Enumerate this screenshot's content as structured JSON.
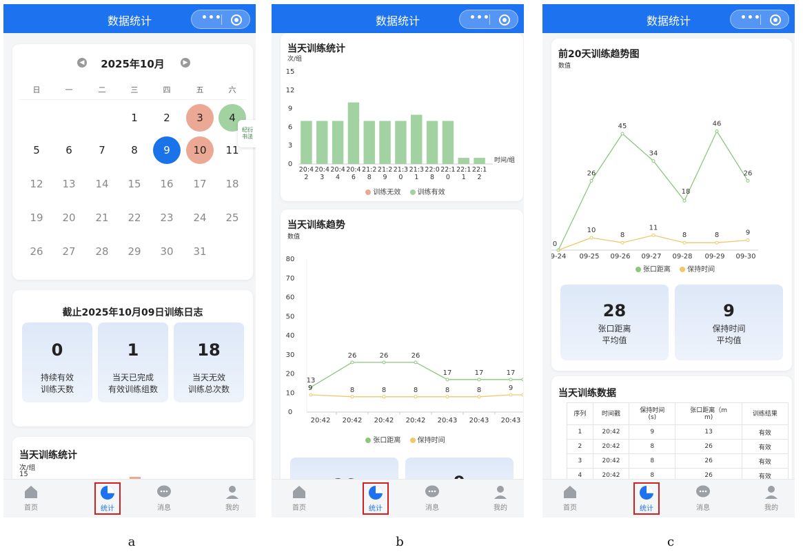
{
  "nav": {
    "title": "数据统计",
    "more_icon": "more-dots-icon",
    "close_icon": "target-circle-icon"
  },
  "tabbar": {
    "items": [
      {
        "label": "首页",
        "icon": "home-icon"
      },
      {
        "label": "统计",
        "icon": "pie-chart-icon",
        "active": true
      },
      {
        "label": "消息",
        "icon": "chat-bubble-icon"
      },
      {
        "label": "我的",
        "icon": "user-icon"
      }
    ]
  },
  "captions": {
    "a": "a",
    "b": "b",
    "c": "c"
  },
  "colors": {
    "primary": "#1d72f0",
    "salmon": "#eba894",
    "green": "#a2d2a1",
    "selected": "#1a73e8",
    "line_green": "#8bc77c",
    "line_yellow": "#f0c86a",
    "highlight_border": "#d21f1f"
  },
  "calendar": {
    "month_label": "2025年10月",
    "weekdays": [
      "日",
      "一",
      "二",
      "三",
      "四",
      "五",
      "六"
    ],
    "badge_text": "纪衍\n书法",
    "weeks": [
      [
        null,
        null,
        null,
        "1",
        "2",
        "3",
        "4"
      ],
      [
        "5",
        "6",
        "7",
        "8",
        "9",
        "10",
        "11"
      ],
      [
        "12",
        "13",
        "14",
        "15",
        "16",
        "17",
        "18"
      ],
      [
        "19",
        "20",
        "21",
        "22",
        "23",
        "24",
        "25"
      ],
      [
        "26",
        "27",
        "28",
        "29",
        "30",
        "31",
        null
      ]
    ],
    "salmon_days": [
      "3",
      "10"
    ],
    "green_days": [
      "4"
    ],
    "selected_day": "9"
  },
  "log": {
    "title": "截止2025年10月09日训练日志",
    "stats": [
      {
        "value": "0",
        "label1": "持续有效",
        "label2": "训练天数"
      },
      {
        "value": "1",
        "label1": "当天已完成",
        "label2": "有效训练组数"
      },
      {
        "value": "18",
        "label1": "当天无效",
        "label2": "训练总次数"
      }
    ]
  },
  "daily_stats_peek": {
    "title": "当天训练统计",
    "unit": "次/组",
    "first_tick": "15"
  },
  "daily_stats": {
    "title": "当天训练统计",
    "unit": "次/组",
    "x_axis_name": "时间/组",
    "legend_invalid": "训练无效",
    "legend_valid": "训练有效"
  },
  "daily_trend": {
    "title": "当天训练趋势",
    "unit": "数值",
    "legend_open": "张口距离",
    "legend_hold": "保持时间",
    "peek_values": [
      "26",
      "9"
    ]
  },
  "trend20": {
    "title": "前20天训练趋势图",
    "unit": "数值",
    "legend_open": "张口距离",
    "legend_hold": "保持时间",
    "stats": [
      {
        "value": "28",
        "label1": "张口距离",
        "label2": "平均值"
      },
      {
        "value": "9",
        "label1": "保持时间",
        "label2": "平均值"
      }
    ]
  },
  "today_table": {
    "title": "当天训练数据",
    "headers": [
      "序列",
      "时间戳",
      "保持时间\n(s)",
      "张口距离（m\nm)",
      "训练结果"
    ],
    "rows": [
      [
        "1",
        "20:42",
        "9",
        "13",
        "有效"
      ],
      [
        "2",
        "20:42",
        "8",
        "26",
        "有效"
      ],
      [
        "3",
        "20:42",
        "8",
        "26",
        "有效"
      ],
      [
        "4",
        "20:42",
        "8",
        "26",
        "有效"
      ]
    ]
  },
  "chart_data": [
    {
      "type": "bar",
      "title": "当天训练统计",
      "ylabel": "次/组",
      "xlabel": "时间/组",
      "ylim": [
        0,
        15
      ],
      "yticks": [
        0,
        3,
        6,
        9,
        12,
        15
      ],
      "categories": [
        "20:42",
        "20:43",
        "20:44",
        "20:46",
        "20:48",
        "21:29",
        "21:30",
        "21:31",
        "21:38",
        "22:00",
        "22:11",
        "22:12"
      ],
      "category_lines": [
        [
          "20:4",
          "2"
        ],
        [
          "20:4",
          "3"
        ],
        [
          "20:4",
          "4"
        ],
        [
          "20:4",
          "6"
        ],
        [
          "21:2",
          "8"
        ],
        [
          "21:2",
          "9"
        ],
        [
          "21:3",
          "0"
        ],
        [
          "21:3",
          "1"
        ],
        [
          "22:0",
          "8"
        ],
        [
          "22:1",
          "0"
        ],
        [
          "22:1",
          "1"
        ],
        [
          "22:1",
          "2"
        ]
      ],
      "series": [
        {
          "name": "训练有效",
          "values": [
            7,
            7,
            7,
            10,
            7,
            7,
            7,
            8,
            7,
            7,
            1,
            null
          ]
        },
        {
          "name": "训练无效",
          "values": [
            0,
            0,
            0,
            0,
            0,
            0,
            0,
            0,
            0,
            0,
            0,
            0
          ]
        }
      ],
      "last_bar_value": 1,
      "legend": "bottom"
    },
    {
      "type": "line",
      "title": "当天训练趋势",
      "ylabel": "数值",
      "ylim": [
        0,
        80
      ],
      "yticks": [
        0,
        10,
        20,
        30,
        40,
        50,
        60,
        70,
        80
      ],
      "categories": [
        "20:42",
        "20:42",
        "20:42",
        "20:42",
        "20:43",
        "20:43",
        "20:43"
      ],
      "series": [
        {
          "name": "张口距离",
          "values": [
            13,
            26,
            26,
            26,
            17,
            17,
            17
          ]
        },
        {
          "name": "保持时间",
          "values": [
            9,
            8,
            8,
            8,
            8,
            8,
            9
          ]
        }
      ],
      "legend": "bottom"
    },
    {
      "type": "line",
      "title": "前20天训练趋势图",
      "ylabel": "数值",
      "categories": [
        "09-24",
        "09-25",
        "09-26",
        "09-27",
        "09-28",
        "09-29",
        "09-30"
      ],
      "series": [
        {
          "name": "张口距离",
          "values": [
            0,
            26,
            45,
            34,
            18,
            46,
            26
          ]
        },
        {
          "name": "保持时间",
          "values": [
            null,
            10,
            8,
            11,
            8,
            8,
            9
          ]
        }
      ],
      "legend": "bottom"
    }
  ]
}
